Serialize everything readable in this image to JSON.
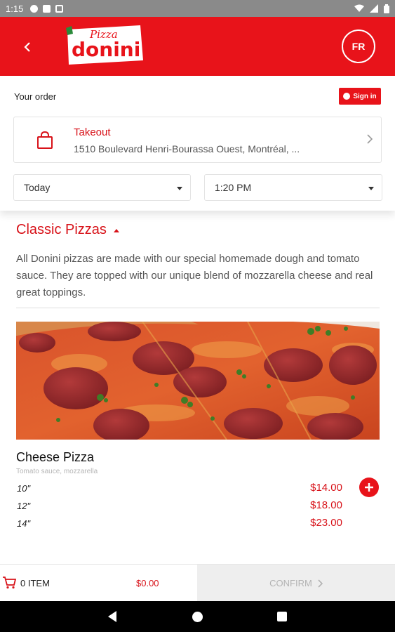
{
  "status_bar": {
    "time": "1:15"
  },
  "header": {
    "logo": {
      "script_text": "Pizza",
      "brand_text": "donini"
    },
    "language_button": "FR",
    "brand_color": "#e8131a"
  },
  "order": {
    "title": "Your order",
    "sign_in_label": "Sign in",
    "mode_label": "Takeout",
    "address": "1510 Boulevard Henri-Bourassa Ouest, Montréal, ...",
    "day_select": "Today",
    "time_select": "1:20 PM"
  },
  "menu": {
    "category_title": "Classic Pizzas",
    "category_description": "All Donini pizzas are made with our special homemade dough and tomato sauce. They are topped with our unique blend of mozzarella cheese and real great toppings.",
    "item": {
      "name": "Cheese Pizza",
      "ingredients": "Tomato sauce, mozzarella",
      "sizes": [
        {
          "size": "10\"",
          "price": "$14.00"
        },
        {
          "size": "12\"",
          "price": "$18.00"
        },
        {
          "size": "14\"",
          "price": "$23.00"
        }
      ]
    }
  },
  "cart": {
    "count_label": "0 ITEM",
    "total": "$0.00",
    "confirm_label": "CONFIRM"
  }
}
